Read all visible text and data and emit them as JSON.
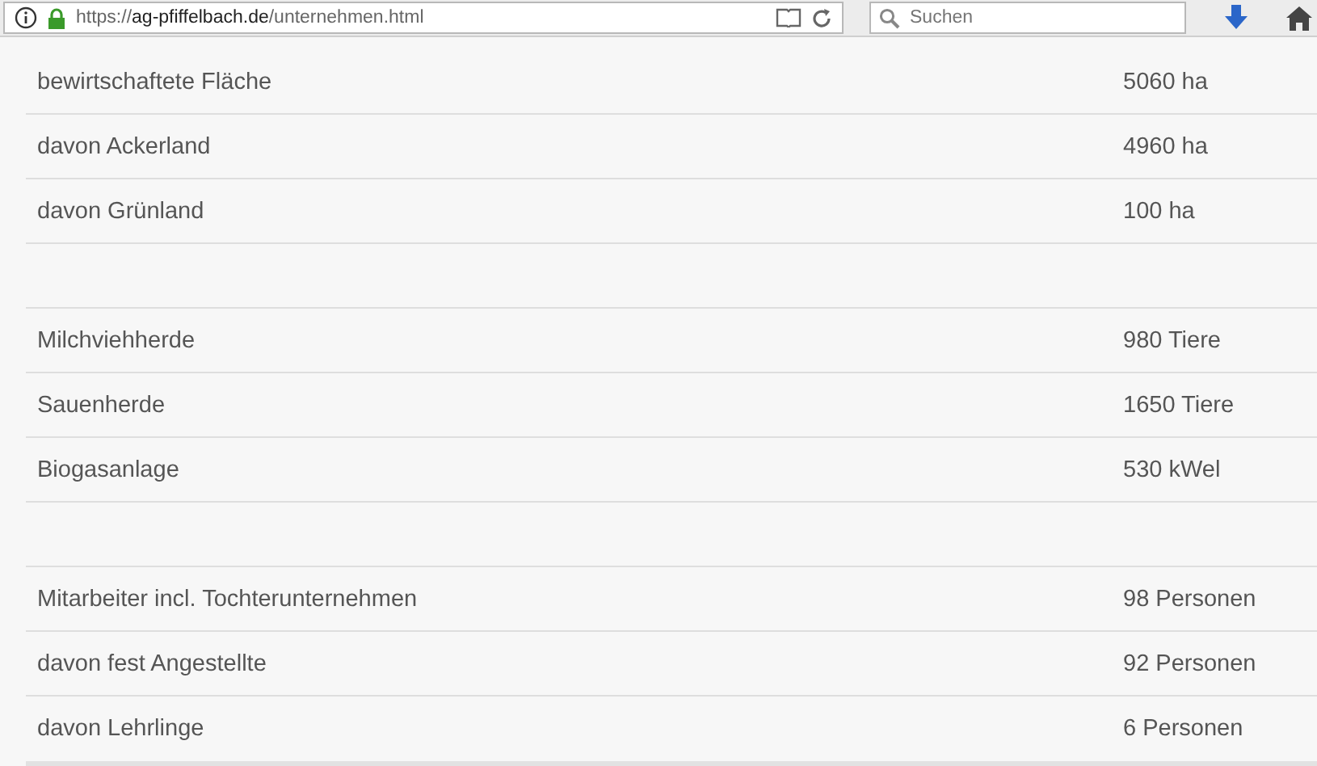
{
  "browser": {
    "address": {
      "scheme": "https://",
      "host": "ag-pfiffelbach.de",
      "path": "/unternehmen.html"
    },
    "search": {
      "placeholder": "Suchen"
    }
  },
  "groups": [
    {
      "rows": [
        {
          "label": "bewirtschaftete Fläche",
          "value": "5060 ha"
        },
        {
          "label": "davon Ackerland",
          "value": "4960 ha"
        },
        {
          "label": "davon Grünland",
          "value": "100 ha"
        }
      ]
    },
    {
      "rows": [
        {
          "label": "Milchviehherde",
          "value": "980 Tiere"
        },
        {
          "label": "Sauenherde",
          "value": "1650 Tiere"
        },
        {
          "label": "Biogasanlage",
          "value": "530 kWel"
        }
      ]
    },
    {
      "rows": [
        {
          "label": "Mitarbeiter incl. Tochterunternehmen",
          "value": "98 Personen"
        },
        {
          "label": "davon fest Angestellte",
          "value": "92 Personen"
        },
        {
          "label": "davon Lehrlinge",
          "value": "6 Personen"
        }
      ]
    }
  ]
}
